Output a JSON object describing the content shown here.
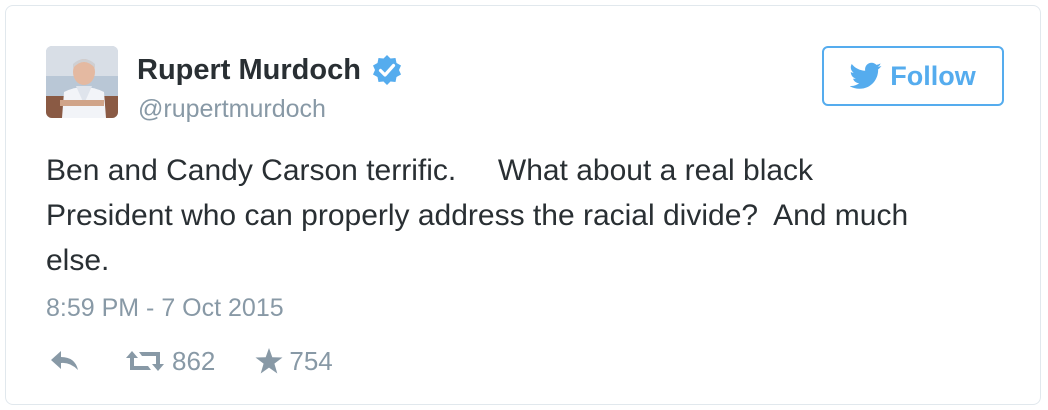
{
  "tweet": {
    "author_name": "Rupert Murdoch",
    "handle": "@rupertmurdoch",
    "follow_label": "Follow",
    "text": "Ben and Candy Carson terrific.     What about a real black\nPresident who can properly address the racial divide?  And much\nelse.",
    "timestamp": "8:59 PM - 7 Oct 2015",
    "retweet_count": "862",
    "favorite_count": "754"
  },
  "icons": {
    "avatar": "profile-photo",
    "verified": "verified-badge-icon",
    "follow": "twitter-bird-icon",
    "reply": "reply-icon",
    "retweet": "retweet-icon",
    "favorite": "star-icon"
  },
  "colors": {
    "accent": "#55acee",
    "text": "#292f33",
    "muted": "#8899a6",
    "border": "#e1e8ed"
  }
}
